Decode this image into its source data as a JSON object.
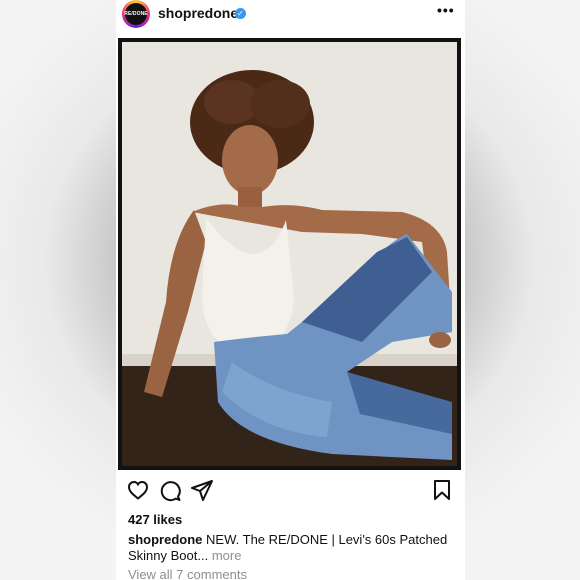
{
  "post": {
    "username": "shopredone",
    "avatar_text": "RE/DONE",
    "verified_icon": "verified-badge-icon",
    "likes": "427 likes",
    "caption_username": "shopredone",
    "caption_text": "NEW. The RE/DONE | Levi's 60s Patched Skinny Boot...",
    "caption_more": "more",
    "view_comments": "View all 7 comments"
  },
  "icons": {
    "more": "more-options-icon",
    "like": "heart-icon",
    "comment": "comment-icon",
    "share": "share-icon",
    "save": "bookmark-icon"
  },
  "colors": {
    "verified": "#3897f0",
    "text": "#111111",
    "muted": "#8e8e8e"
  }
}
